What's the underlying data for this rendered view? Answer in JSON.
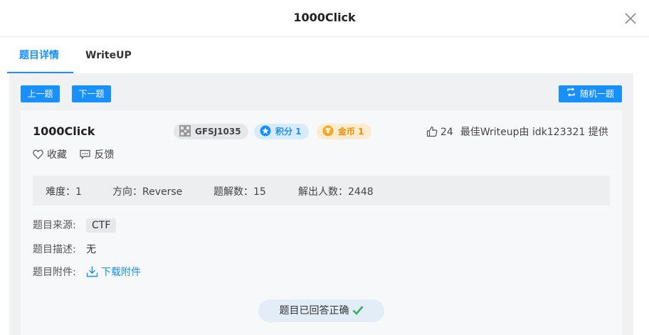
{
  "dialog": {
    "title": "1000Click"
  },
  "tabs": [
    {
      "label": "题目详情",
      "active": true
    },
    {
      "label": "WriteUP",
      "active": false
    }
  ],
  "toolbar": {
    "prev_label": "上一题",
    "next_label": "下一题",
    "random_label": "随机一题"
  },
  "challenge": {
    "title": "1000Click",
    "code": "GFSJ1035",
    "score_label": "积分 1",
    "coin_label": "金币 1",
    "likes": "24",
    "best_writeup": "最佳Writeup由 idk123321 提供",
    "favorite_label": "收藏",
    "feedback_label": "反馈"
  },
  "stats": {
    "difficulty": "难度：1",
    "direction": "方向：Reverse",
    "writeups": "题解数：15",
    "solvers": "解出人数：2448"
  },
  "details": {
    "source_label": "题目来源:",
    "source_value": "CTF",
    "desc_label": "题目描述:",
    "desc_value": "无",
    "attach_label": "题目附件:",
    "attach_link": "下载附件"
  },
  "status": {
    "solved_label": "题目已回答正确"
  },
  "colors": {
    "accent": "#1890ff",
    "success": "#2db35d",
    "coin": "#f5a623"
  }
}
